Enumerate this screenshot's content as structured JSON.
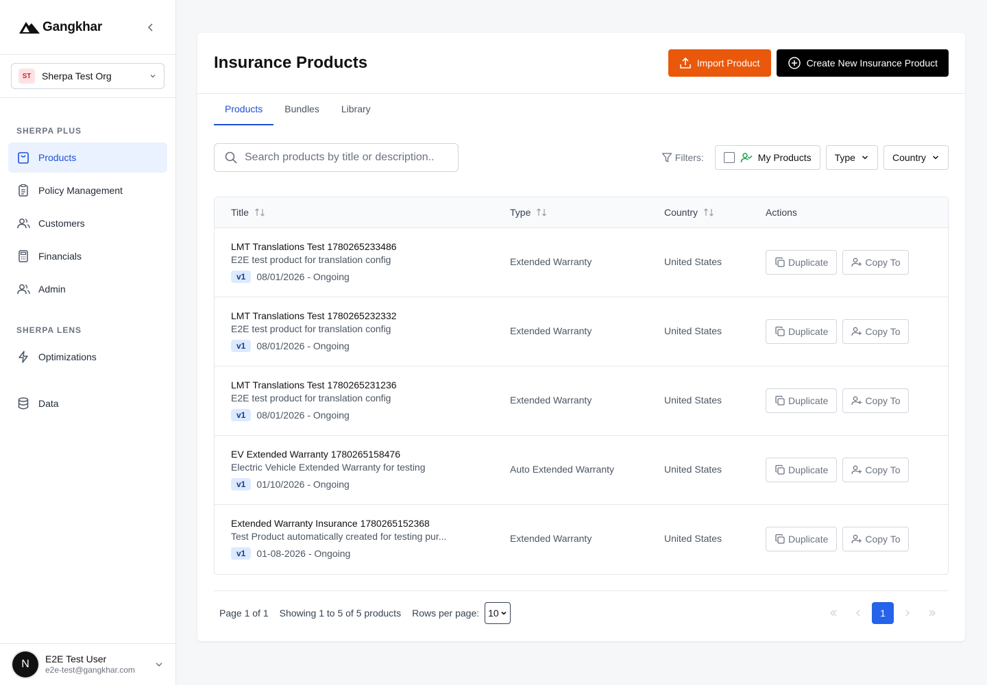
{
  "brand": {
    "name": "Gangkhar"
  },
  "org": {
    "badge": "ST",
    "name": "Sherpa Test Org"
  },
  "sidebar": {
    "section1": "SHERPA PLUS",
    "items1": [
      {
        "label": "Products",
        "icon": "shopping-bag-icon"
      },
      {
        "label": "Policy Management",
        "icon": "clipboard-icon"
      },
      {
        "label": "Customers",
        "icon": "users-icon"
      },
      {
        "label": "Financials",
        "icon": "calculator-icon"
      },
      {
        "label": "Admin",
        "icon": "users-icon"
      }
    ],
    "section2": "SHERPA LENS",
    "items2": [
      {
        "label": "Optimizations",
        "icon": "lightning-icon"
      }
    ],
    "items3": [
      {
        "label": "Data",
        "icon": "database-icon"
      }
    ]
  },
  "user": {
    "initial": "N",
    "name": "E2E Test User",
    "email": "e2e-test@gangkhar.com"
  },
  "header": {
    "title": "Insurance Products",
    "import_label": "Import Product",
    "create_label": "Create New Insurance Product"
  },
  "tabs": [
    "Products",
    "Bundles",
    "Library"
  ],
  "search": {
    "placeholder": "Search products by title or description.."
  },
  "filters": {
    "label": "Filters:",
    "my_products": "My Products",
    "type": "Type",
    "country": "Country"
  },
  "table": {
    "headers": [
      "Title",
      "Type",
      "Country",
      "Actions"
    ],
    "duplicate_label": "Duplicate",
    "copy_label": "Copy To",
    "rows": [
      {
        "title": "LMT Translations Test 1780265233486",
        "desc": "E2E test product for translation config",
        "version": "v1",
        "dates": "08/01/2026 - Ongoing",
        "type": "Extended Warranty",
        "country": "United States"
      },
      {
        "title": "LMT Translations Test 1780265232332",
        "desc": "E2E test product for translation config",
        "version": "v1",
        "dates": "08/01/2026 - Ongoing",
        "type": "Extended Warranty",
        "country": "United States"
      },
      {
        "title": "LMT Translations Test 1780265231236",
        "desc": "E2E test product for translation config",
        "version": "v1",
        "dates": "08/01/2026 - Ongoing",
        "type": "Extended Warranty",
        "country": "United States"
      },
      {
        "title": "EV Extended Warranty 1780265158476",
        "desc": "Electric Vehicle Extended Warranty for testing",
        "version": "v1",
        "dates": "01/10/2026 - Ongoing",
        "type": "Auto Extended Warranty",
        "country": "United States"
      },
      {
        "title": "Extended Warranty Insurance 1780265152368",
        "desc": "Test Product automatically created for testing pur...",
        "version": "v1",
        "dates": "01-08-2026 - Ongoing",
        "type": "Extended Warranty",
        "country": "United States"
      }
    ]
  },
  "pager": {
    "page_text": "Page 1 of 1",
    "showing_text": "Showing 1 to 5 of 5 products",
    "rows_label": "Rows per page:",
    "rows_value": "10",
    "current_page": "1"
  },
  "colors": {
    "accent": "#1d4ed8",
    "import": "#ea580c",
    "create": "#000000",
    "page_active": "#2563eb"
  }
}
